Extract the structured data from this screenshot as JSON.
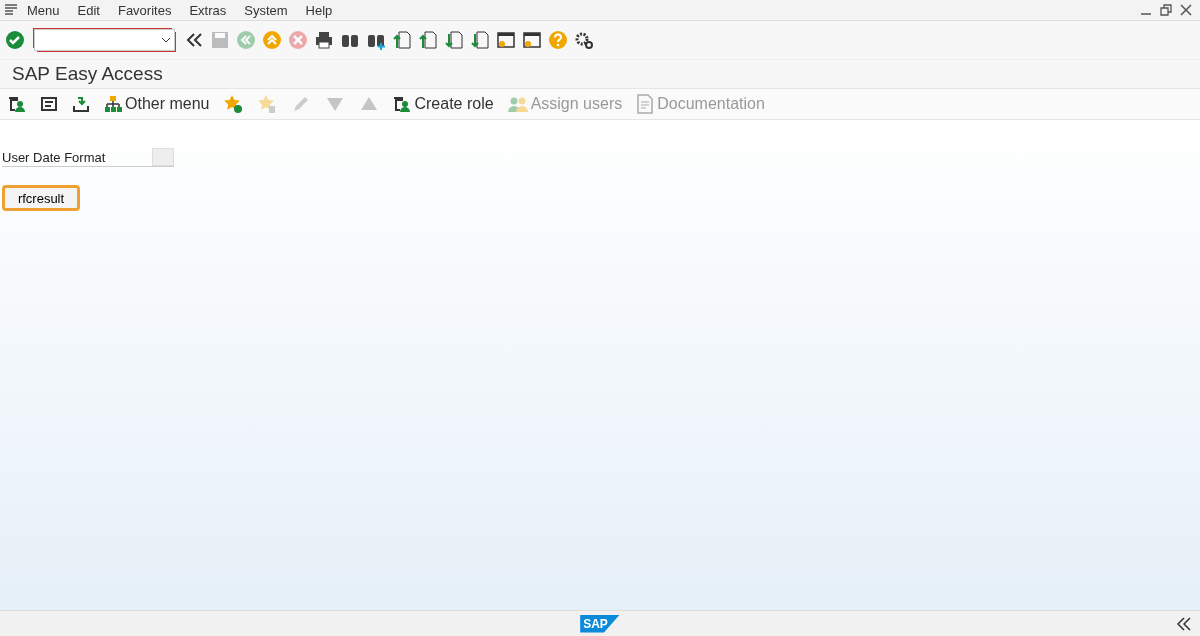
{
  "menu_bar": {
    "items": [
      "Menu",
      "Edit",
      "Favorites",
      "Extras",
      "System",
      "Help"
    ]
  },
  "system_toolbar": {
    "buttons": [
      {
        "kind": "check",
        "disabled": false
      },
      {
        "kind": "collapse",
        "disabled": false
      },
      {
        "kind": "save",
        "disabled": true
      },
      {
        "kind": "back",
        "disabled": true
      },
      {
        "kind": "exit",
        "disabled": false
      },
      {
        "kind": "cancel",
        "disabled": true
      },
      {
        "kind": "print",
        "disabled": false
      },
      {
        "kind": "find",
        "disabled": false
      },
      {
        "kind": "findnext",
        "disabled": false
      },
      {
        "kind": "first",
        "disabled": false
      },
      {
        "kind": "prev",
        "disabled": false
      },
      {
        "kind": "next",
        "disabled": false
      },
      {
        "kind": "last",
        "disabled": false
      },
      {
        "kind": "newsession",
        "disabled": false
      },
      {
        "kind": "shortcut",
        "disabled": false
      },
      {
        "kind": "help",
        "disabled": false
      },
      {
        "kind": "settings",
        "disabled": false
      }
    ]
  },
  "title": "SAP Easy Access",
  "app_toolbar": [
    {
      "kind": "userfolder",
      "disabled": false
    },
    {
      "kind": "sapmenu",
      "disabled": false
    },
    {
      "kind": "tray",
      "disabled": false
    },
    {
      "kind": "tree",
      "label": "Other menu",
      "disabled": false
    },
    {
      "kind": "addfav",
      "disabled": false
    },
    {
      "kind": "delfav",
      "disabled": true
    },
    {
      "kind": "edit",
      "disabled": true
    },
    {
      "kind": "down",
      "disabled": true
    },
    {
      "kind": "up",
      "disabled": true
    },
    {
      "kind": "userfolder",
      "label": "Create role",
      "disabled": false
    },
    {
      "kind": "users",
      "label": "Assign users",
      "disabled": true
    },
    {
      "kind": "doc",
      "label": "Documentation",
      "disabled": true
    }
  ],
  "form": {
    "label": "User Date Format"
  },
  "button": {
    "label": "rfcresult",
    "focused": true
  },
  "status_bar": {
    "logo_text": "SAP"
  }
}
